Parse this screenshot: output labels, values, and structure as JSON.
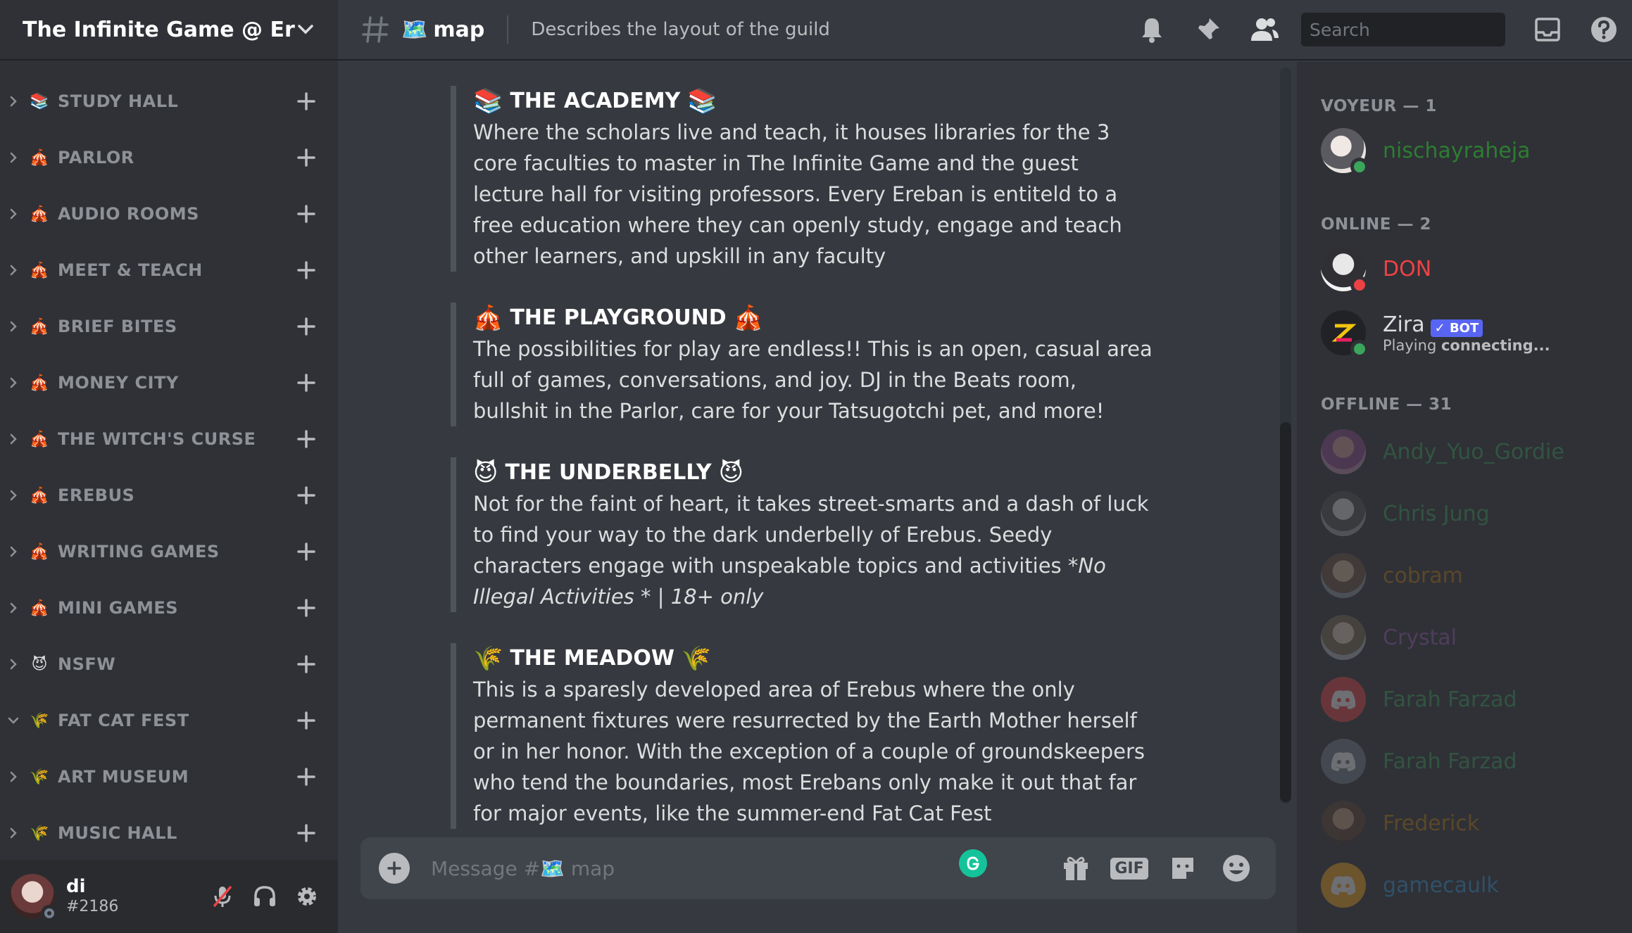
{
  "server": {
    "name": "The Infinite Game @ Ere..."
  },
  "categories": [
    {
      "emoji": "📚",
      "label": "STUDY HALL",
      "expanded": false
    },
    {
      "emoji": "🎪",
      "label": "PARLOR",
      "expanded": false
    },
    {
      "emoji": "🎪",
      "label": "AUDIO ROOMS",
      "expanded": false
    },
    {
      "emoji": "🎪",
      "label": "MEET & TEACH",
      "expanded": false
    },
    {
      "emoji": "🎪",
      "label": "BRIEF BITES",
      "expanded": false
    },
    {
      "emoji": "🎪",
      "label": "MONEY CITY",
      "expanded": false
    },
    {
      "emoji": "🎪",
      "label": "THE WITCH'S CURSE",
      "expanded": false
    },
    {
      "emoji": "🎪",
      "label": "EREBUS",
      "expanded": false
    },
    {
      "emoji": "🎪",
      "label": "WRITING GAMES",
      "expanded": false
    },
    {
      "emoji": "🎪",
      "label": "MINI GAMES",
      "expanded": false
    },
    {
      "emoji": "😈",
      "label": "NSFW",
      "expanded": false
    },
    {
      "emoji": "🌾",
      "label": "FAT CAT FEST",
      "expanded": true
    },
    {
      "emoji": "🌾",
      "label": "ART MUSEUM",
      "expanded": false
    },
    {
      "emoji": "🌾",
      "label": "MUSIC HALL",
      "expanded": false
    }
  ],
  "user": {
    "name": "di",
    "tag": "#2186"
  },
  "channel": {
    "emoji": "🗺️",
    "name": "map",
    "topic": "Describes the layout of the guild"
  },
  "search": {
    "placeholder": "Search"
  },
  "sections": [
    {
      "emoji": "📚",
      "title": "THE  ACADEMY",
      "body": "Where the scholars live and teach, it houses libraries for the 3 core faculties to master in The Infinite Game and the guest lecture hall for visiting professors. Every Ereban is entiteld to a free education where they can openly study, engage and teach other learners, and upskill in any faculty",
      "italic": ""
    },
    {
      "emoji": "🎪",
      "title": "THE PLAYGROUND",
      "body": "The possibilities for play are endless!! This is an open, casual area full of games, conversations, and joy. DJ in the Beats room, bullshit in the Parlor, care for your Tatsugotchi pet, and more!",
      "italic": ""
    },
    {
      "emoji": "😈",
      "title": "THE UNDERBELLY",
      "body": "Not for the faint of heart, it takes street-smarts and a dash of luck to find your way to the dark underbelly of Erebus. Seedy characters engage with unspeakable topics and activities ",
      "italic": "*No Illegal Activities * | 18+ only"
    },
    {
      "emoji": "🌾",
      "title": "THE MEADOW",
      "body": "This is a sparesly developed area of Erebus where the only permanent fixtures were resurrected by the Earth Mother herself or in her honor. With the exception of a couple of groundskeepers who tend the boundaries, most Erebans only make it out that far for major events, like the summer-end Fat Cat Fest",
      "italic": ""
    }
  ],
  "composer": {
    "placeholder": "Message #🗺️ map",
    "gif_label": "GIF"
  },
  "members": {
    "groups": [
      {
        "title": "VOYEUR — 1"
      },
      {
        "title": "ONLINE — 2"
      },
      {
        "title": "OFFLINE — 31"
      }
    ],
    "voyeur": [
      {
        "name": "nischayraheja",
        "color": "#2d7d32",
        "status": "online"
      }
    ],
    "online": [
      {
        "name": "DON",
        "color": "#ed4245",
        "status": "dnd"
      },
      {
        "name": "Zira",
        "color": "#dcddde",
        "status": "online",
        "badge": "✓ BOT",
        "activity_prefix": "Playing ",
        "activity": "connecting..."
      }
    ],
    "offline": [
      {
        "name": "Andy_Yuo_Gordie",
        "color": "#3ba55c"
      },
      {
        "name": "Chris Jung",
        "color": "#3ba55c"
      },
      {
        "name": "cobram",
        "color": "#c27c0e"
      },
      {
        "name": "Crystal",
        "color": "#9b59b6"
      },
      {
        "name": "Farah Farzad",
        "color": "#3ba55c"
      },
      {
        "name": "Farah Farzad",
        "color": "#3ba55c"
      },
      {
        "name": "Frederick",
        "color": "#c27c0e"
      },
      {
        "name": "gamecaulk",
        "color": "#3498db"
      }
    ]
  },
  "colors": {
    "online": "#3ba55c",
    "dnd": "#ed4245",
    "accent": "#5865f2"
  }
}
